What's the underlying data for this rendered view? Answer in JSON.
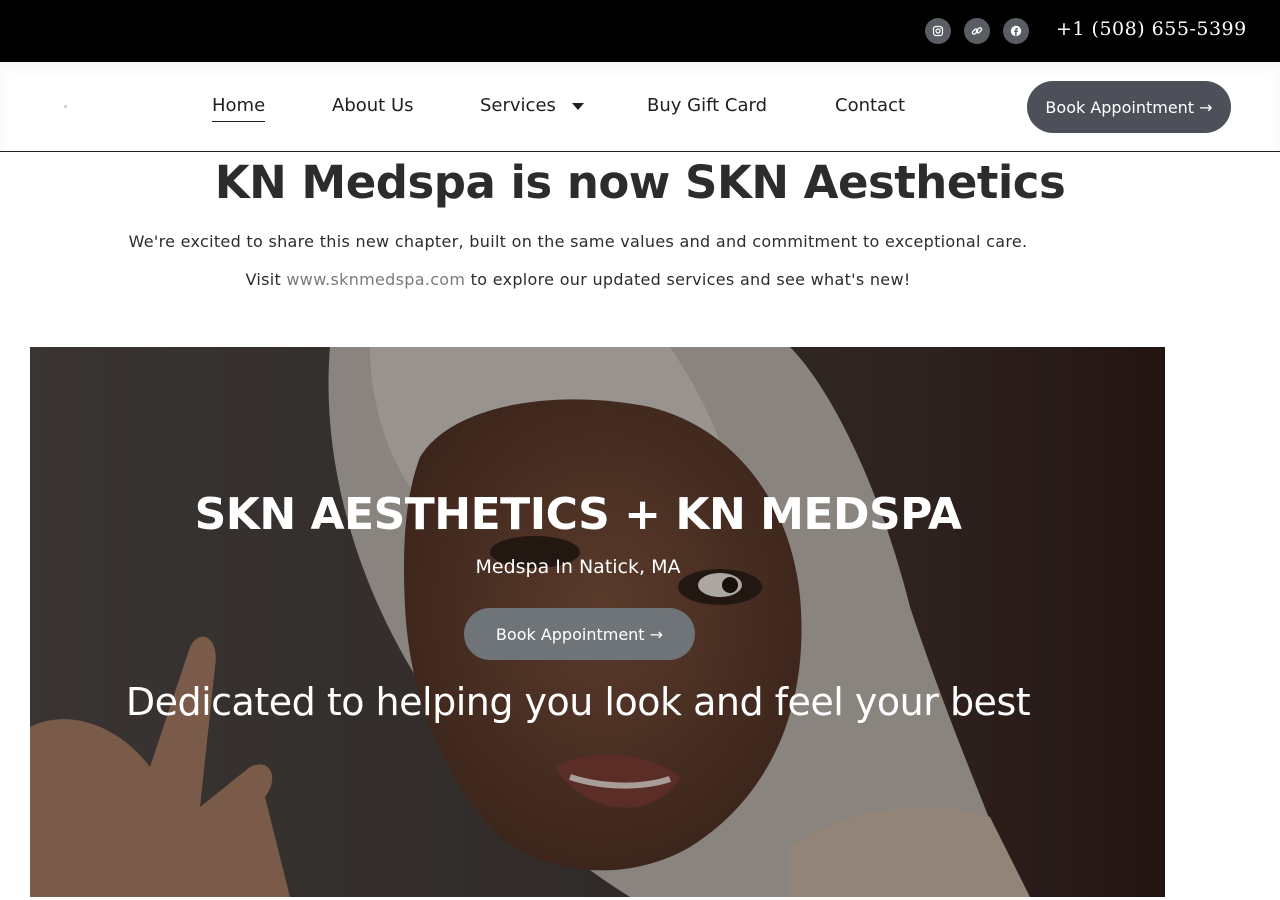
{
  "topbar": {
    "social": [
      {
        "icon": "instagram-icon"
      },
      {
        "icon": "link-icon"
      },
      {
        "icon": "facebook-icon"
      }
    ],
    "phone": "+1 (508) 655-5399"
  },
  "nav": {
    "items": [
      {
        "label": "Home",
        "active": true
      },
      {
        "label": "About Us"
      },
      {
        "label": "Services",
        "has_dropdown": true
      },
      {
        "label": "Buy Gift Card"
      },
      {
        "label": "Contact"
      }
    ],
    "book_button": "Book Appointment →"
  },
  "announcement": {
    "title": "KN Medspa is now SKN Aesthetics",
    "line1": "We're excited to share this new chapter, built on the same values and and commitment to exceptional care.",
    "line2_prefix": "Visit ",
    "line2_link": "www.sknmedspa.com",
    "line2_suffix": " to explore our updated services and see what's new!"
  },
  "hero": {
    "title": "SKN AESTHETICS + KN MEDSPA",
    "subtitle": "Medspa In Natick, MA",
    "book_button": "Book Appointment →",
    "tagline": "Dedicated to helping you look and feel your best"
  },
  "colors": {
    "topbar_bg": "#000000",
    "button_dark": "#4d5058",
    "button_hero": "#6f7479",
    "link_gray": "#7a7a7a"
  }
}
